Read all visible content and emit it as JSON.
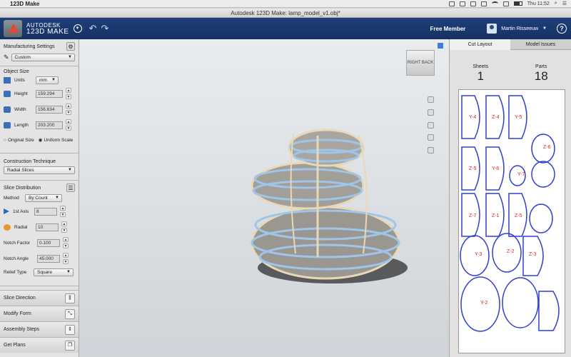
{
  "menubar": {
    "app": "123D Make",
    "clock": "Thu 11:52"
  },
  "window": {
    "title": "Autodesk 123D Make: lamp_model_v1.obj*"
  },
  "header": {
    "brand_line1": "AUTODESK",
    "brand_line2": "123D MAKE",
    "member": "Free Member",
    "username": "Martin Risseeuw",
    "help": "?"
  },
  "left": {
    "mfg_title": "Manufacturing Settings",
    "mfg_value": "Custom",
    "size_title": "Object Size",
    "units_label": "Units",
    "units_value": "mm",
    "height_label": "Height",
    "height_value": "159.294",
    "width_label": "Width",
    "width_value": "156.634",
    "length_label": "Length",
    "length_value": "203.200",
    "original_size": "Original Size",
    "uniform_scale": "Uniform Scale",
    "construction_title": "Construction Technique",
    "construction_value": "Radial Slices",
    "slice_title": "Slice Distribution",
    "method_label": "Method",
    "method_value": "By Count",
    "axis1_label": "1st Axis",
    "axis1_value": "8",
    "radial_label": "Radial",
    "radial_value": "10",
    "notch_factor_label": "Notch Factor",
    "notch_factor_value": "0.100",
    "notch_angle_label": "Notch Angle",
    "notch_angle_value": "45.000",
    "relief_label": "Relief Type",
    "relief_value": "Square",
    "btn_slice_direction": "Slice Direction",
    "btn_modify_form": "Modify Form",
    "btn_assembly": "Assembly Steps",
    "btn_get_plans": "Get Plans"
  },
  "viewport": {
    "cube_left": "RIGHT",
    "cube_right": "BACK"
  },
  "right": {
    "tab_cut": "Cut Layout",
    "tab_issues": "Model Issues",
    "sheets_label": "Sheets",
    "sheets_value": "1",
    "parts_label": "Parts",
    "parts_value": "18",
    "part_labels": [
      "Y-4",
      "Z-4",
      "Y-5",
      "Z-5",
      "Y-6",
      "Z-6",
      "Y-7",
      "Z-7",
      "Z-1",
      "Z-5",
      "Y-3",
      "Z-2",
      "Z-3",
      "Y-2"
    ]
  }
}
